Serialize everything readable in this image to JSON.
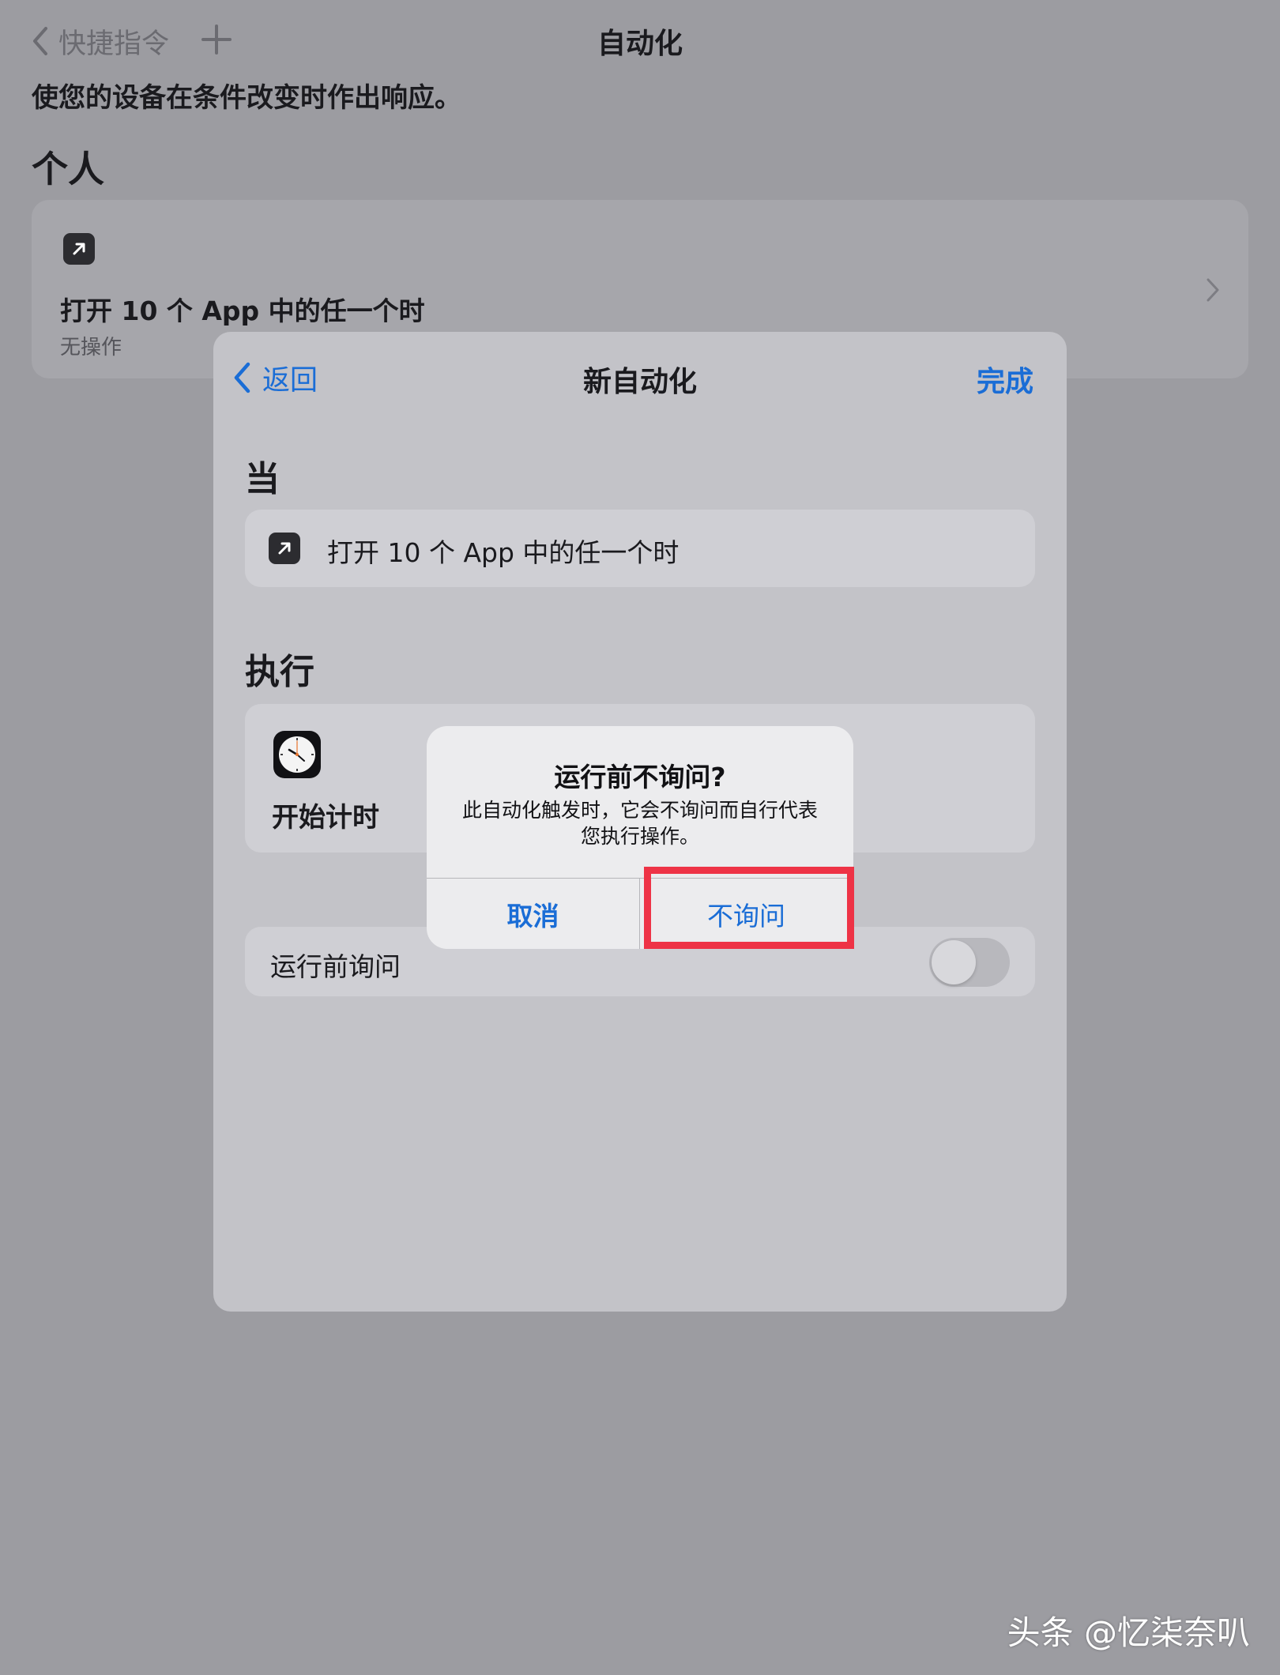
{
  "background": {
    "nav": {
      "back_label": "快捷指令",
      "title": "自动化"
    },
    "subtitle": "使您的设备在条件改变时作出响应。",
    "section_title": "个人",
    "card": {
      "icon": "arrow-up-right-icon",
      "title": "打开 10 个 App 中的任一个时",
      "subtitle": "无操作"
    }
  },
  "sheet": {
    "back_label": "返回",
    "title": "新自动化",
    "done_label": "完成",
    "when_title": "当",
    "trigger_label": "打开 10 个 App 中的任一个时",
    "do_title": "执行",
    "action_label": "开始计时",
    "ask_label": "运行前询问",
    "ask_toggle_on": false
  },
  "alert": {
    "title": "运行前不询问?",
    "message": "此自动化触发时，它会不询问而自行代表您执行操作。",
    "cancel_label": "取消",
    "confirm_label": "不询问"
  },
  "watermark": "头条 @忆柒奈叭",
  "colors": {
    "accent": "#1a6dd6",
    "highlight": "#ee3346"
  }
}
